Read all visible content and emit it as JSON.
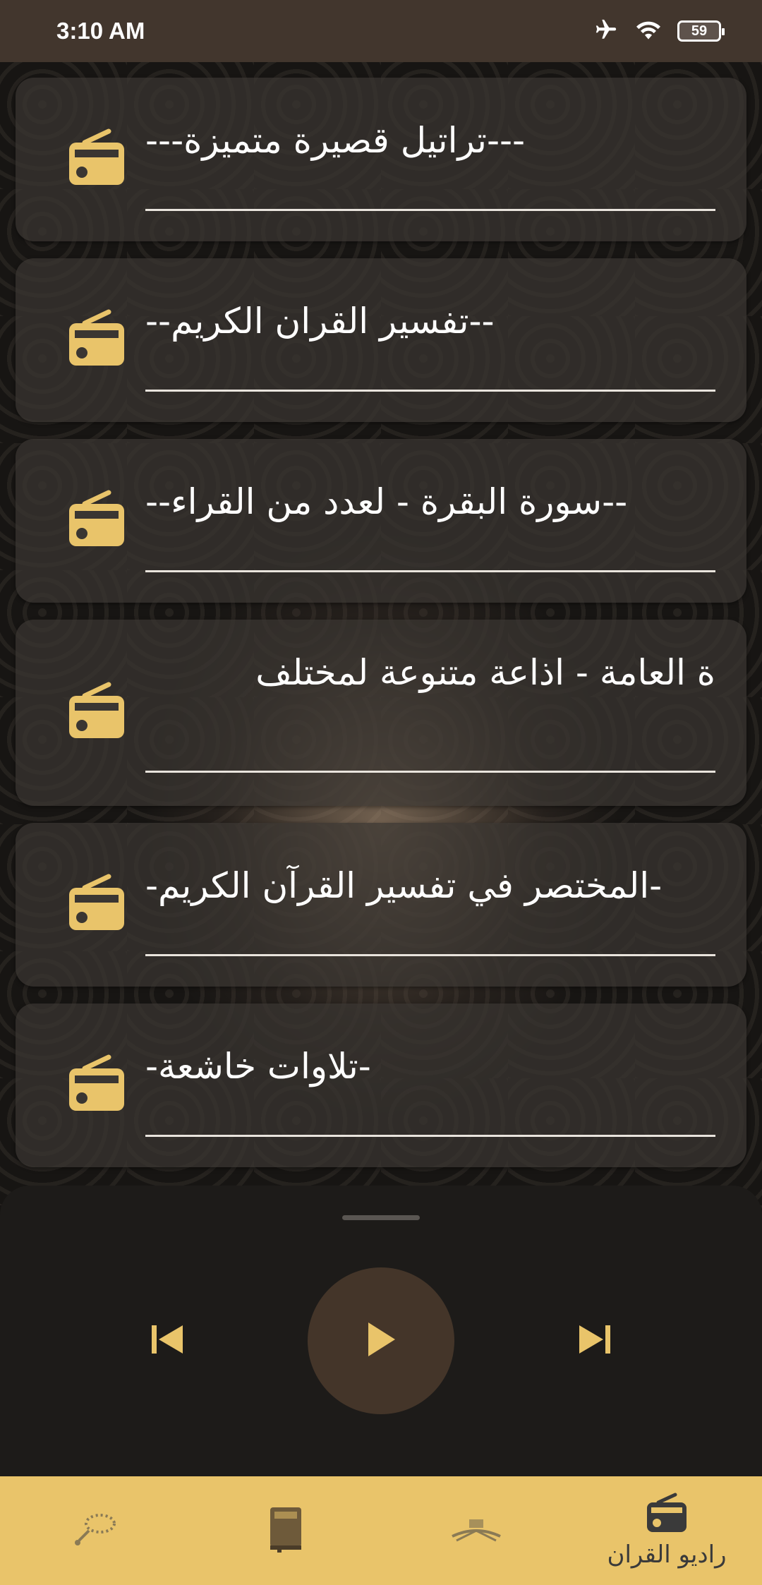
{
  "status_bar": {
    "time": "3:10 AM",
    "battery": "59"
  },
  "stations": [
    {
      "title": "---تراتيل قصيرة متميزة---",
      "icon": "radio-icon"
    },
    {
      "title": "--تفسير القران الكريم--",
      "icon": "radio-icon"
    },
    {
      "title": "--سورة البقرة - لعدد من القراء--",
      "icon": "radio-icon"
    },
    {
      "title": "ة العامة - اذاعة متنوعة لمختلف",
      "icon": "radio-icon"
    },
    {
      "title": "-المختصر في تفسير القرآن الكريم-",
      "icon": "radio-icon"
    },
    {
      "title": "-تلاوات خاشعة-",
      "icon": "radio-icon"
    }
  ],
  "player": {
    "controls": [
      "previous-icon",
      "play-icon",
      "next-icon"
    ]
  },
  "bottom_nav": {
    "items": [
      {
        "icon": "tasbih-icon",
        "label": ""
      },
      {
        "icon": "book-icon",
        "label": ""
      },
      {
        "icon": "quran-stand-icon",
        "label": ""
      },
      {
        "icon": "radio-icon",
        "label": "راديو القران",
        "active": true
      }
    ]
  },
  "colors": {
    "accent": "#e9c46a",
    "status_bar": "#42362d",
    "play_button": "#443529"
  }
}
